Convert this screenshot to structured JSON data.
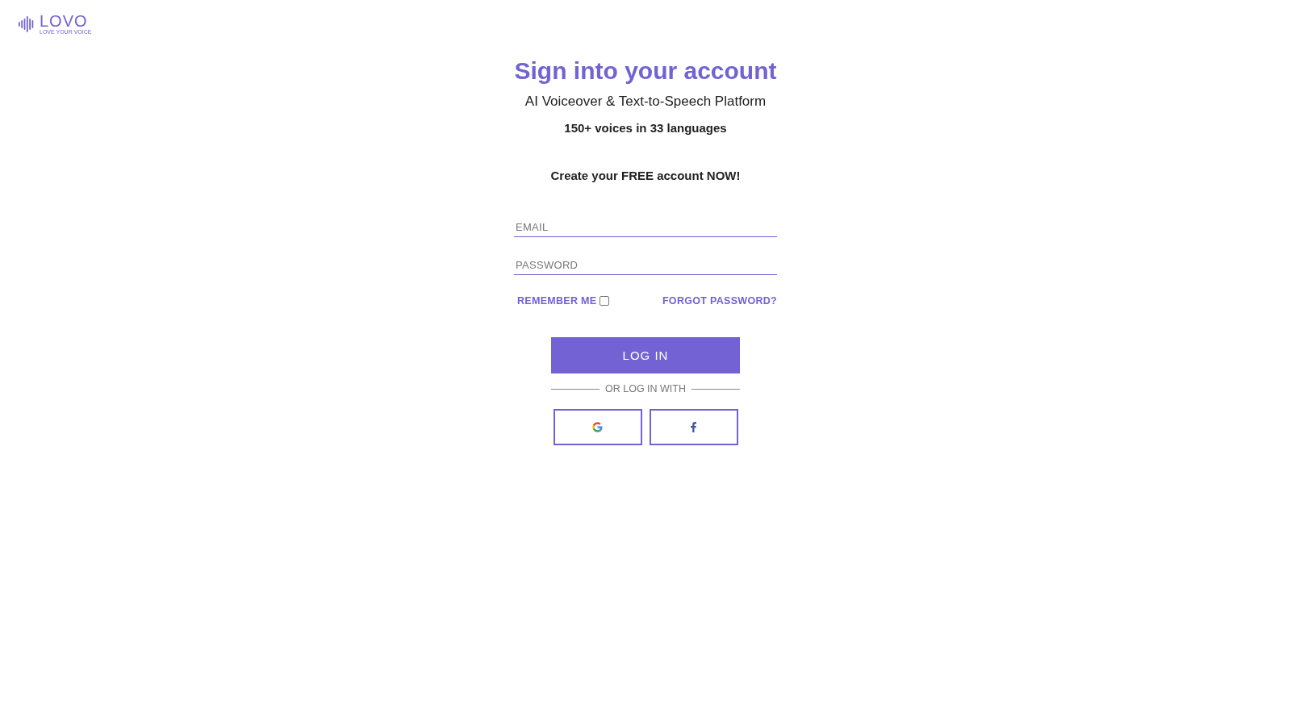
{
  "logo": {
    "name": "LOVO",
    "tagline": "LOVE YOUR VOICE"
  },
  "title": "Sign into your account",
  "subtitle": "AI Voiceover & Text-to-Speech Platform",
  "voices": "150+ voices in 33 languages",
  "promo": "Create your FREE account NOW!",
  "fields": [
    {
      "placeholder": "EMAIL"
    },
    {
      "placeholder": "PASSWORD"
    }
  ],
  "remember": {
    "label": "REMEMBER ME",
    "checked": false
  },
  "forgot": "FORGOT PASSWORD?",
  "login_button": "LOG IN",
  "divider": "OR LOG IN WITH",
  "social": [
    {
      "kind": "google"
    },
    {
      "kind": "facebook"
    }
  ]
}
